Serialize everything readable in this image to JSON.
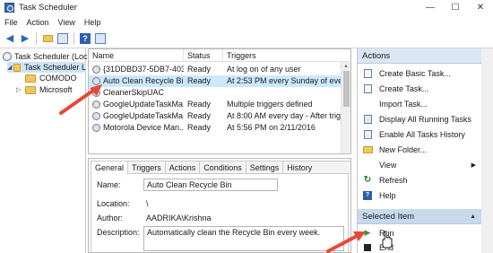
{
  "window": {
    "title": "Task Scheduler",
    "controls": {
      "minimize": "—",
      "maximize": "☐",
      "close": "✕"
    }
  },
  "menu": [
    "File",
    "Action",
    "View",
    "Help"
  ],
  "toolbar": {
    "back": "◀",
    "forward": "▶",
    "help": "?"
  },
  "tree": {
    "root": "Task Scheduler (Loc",
    "library": "Task Scheduler L",
    "folders": [
      "COMODO",
      "Microsoft"
    ]
  },
  "tasks": {
    "columns": [
      "Name",
      "Status",
      "Triggers"
    ],
    "rows": [
      {
        "name": "{31DDBD37-5DB7-403...",
        "status": "Ready",
        "triggers": "At log on of any user"
      },
      {
        "name": "Auto Clean Recycle Bin",
        "status": "Ready",
        "triggers": "At 2:53 PM every Sunday of every w"
      },
      {
        "name": "CleanerSkipUAC",
        "status": "",
        "triggers": ""
      },
      {
        "name": "GoogleUpdateTaskMa...",
        "status": "Ready",
        "triggers": "Multiple triggers defined"
      },
      {
        "name": "GoogleUpdateTaskMa...",
        "status": "Ready",
        "triggers": "At 8:00 AM every day - After trigger"
      },
      {
        "name": "Motorola Device Man...",
        "status": "Ready",
        "triggers": "At 5:56 PM on 2/11/2016"
      }
    ],
    "selected_index": 1
  },
  "details": {
    "tabs": [
      "General",
      "Triggers",
      "Actions",
      "Conditions",
      "Settings",
      "History (disabled)"
    ],
    "active_tab": "General",
    "fields": {
      "name_label": "Name:",
      "name_value": "Auto Clean Recycle Bin",
      "location_label": "Location:",
      "location_value": "\\",
      "author_label": "Author:",
      "author_value": "AADRIKA\\Krishna",
      "description_label": "Description:",
      "description_value": "Automatically clean the Recycle Bin every week."
    }
  },
  "actions": {
    "header": "Actions",
    "items": [
      {
        "label": "Create Basic Task...",
        "icon": "create-basic-task-icon"
      },
      {
        "label": "Create Task...",
        "icon": "create-task-icon"
      },
      {
        "label": "Import Task...",
        "icon": ""
      },
      {
        "label": "Display All Running Tasks",
        "icon": "running-tasks-icon"
      },
      {
        "label": "Enable All Tasks History",
        "icon": "history-icon"
      },
      {
        "label": "New Folder...",
        "icon": "folder-icon"
      },
      {
        "label": "View",
        "icon": "",
        "submenu": "▶"
      },
      {
        "label": "Refresh",
        "icon": "refresh-icon"
      },
      {
        "label": "Help",
        "icon": "help-icon"
      }
    ],
    "selected_header": "Selected Item",
    "selected_items": [
      {
        "label": "Run",
        "icon": "run-icon"
      },
      {
        "label": "End",
        "icon": "end-icon"
      }
    ],
    "collapse_glyph": "▲"
  },
  "colors": {
    "annotation_arrow": "#e8483a",
    "selection": "#cce8ff"
  }
}
